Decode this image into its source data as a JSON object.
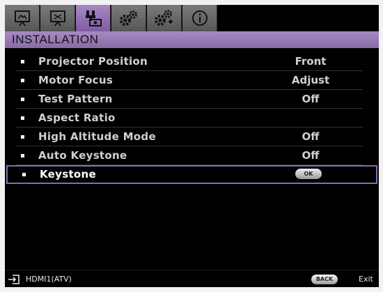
{
  "menu": {
    "tabs": [
      {
        "icon": "display-icon",
        "active": false
      },
      {
        "icon": "picture-icon",
        "active": false
      },
      {
        "icon": "installation-icon",
        "active": true
      },
      {
        "icon": "settings-gears-icon",
        "active": false
      },
      {
        "icon": "advanced-settings-gears-icon",
        "active": false
      },
      {
        "icon": "info-icon",
        "active": false
      }
    ],
    "section_title": "INSTALLATION",
    "items": [
      {
        "label": "Projector Position",
        "value": "Front"
      },
      {
        "label": "Motor Focus",
        "value": "Adjust"
      },
      {
        "label": "Test Pattern",
        "value": "Off"
      },
      {
        "label": "Aspect Ratio",
        "value": ""
      },
      {
        "label": "High Altitude Mode",
        "value": "Off"
      },
      {
        "label": "Auto Keystone",
        "value": "Off"
      },
      {
        "label": "Keystone",
        "value": "OK",
        "selected": true
      }
    ]
  },
  "status": {
    "source": "HDMI1(ATV)",
    "back_label": "BACK",
    "exit_label": "Exit"
  },
  "colors": {
    "accent": "#8a6aa8",
    "tab_gray": "#6a6a6a",
    "background": "#000000"
  }
}
